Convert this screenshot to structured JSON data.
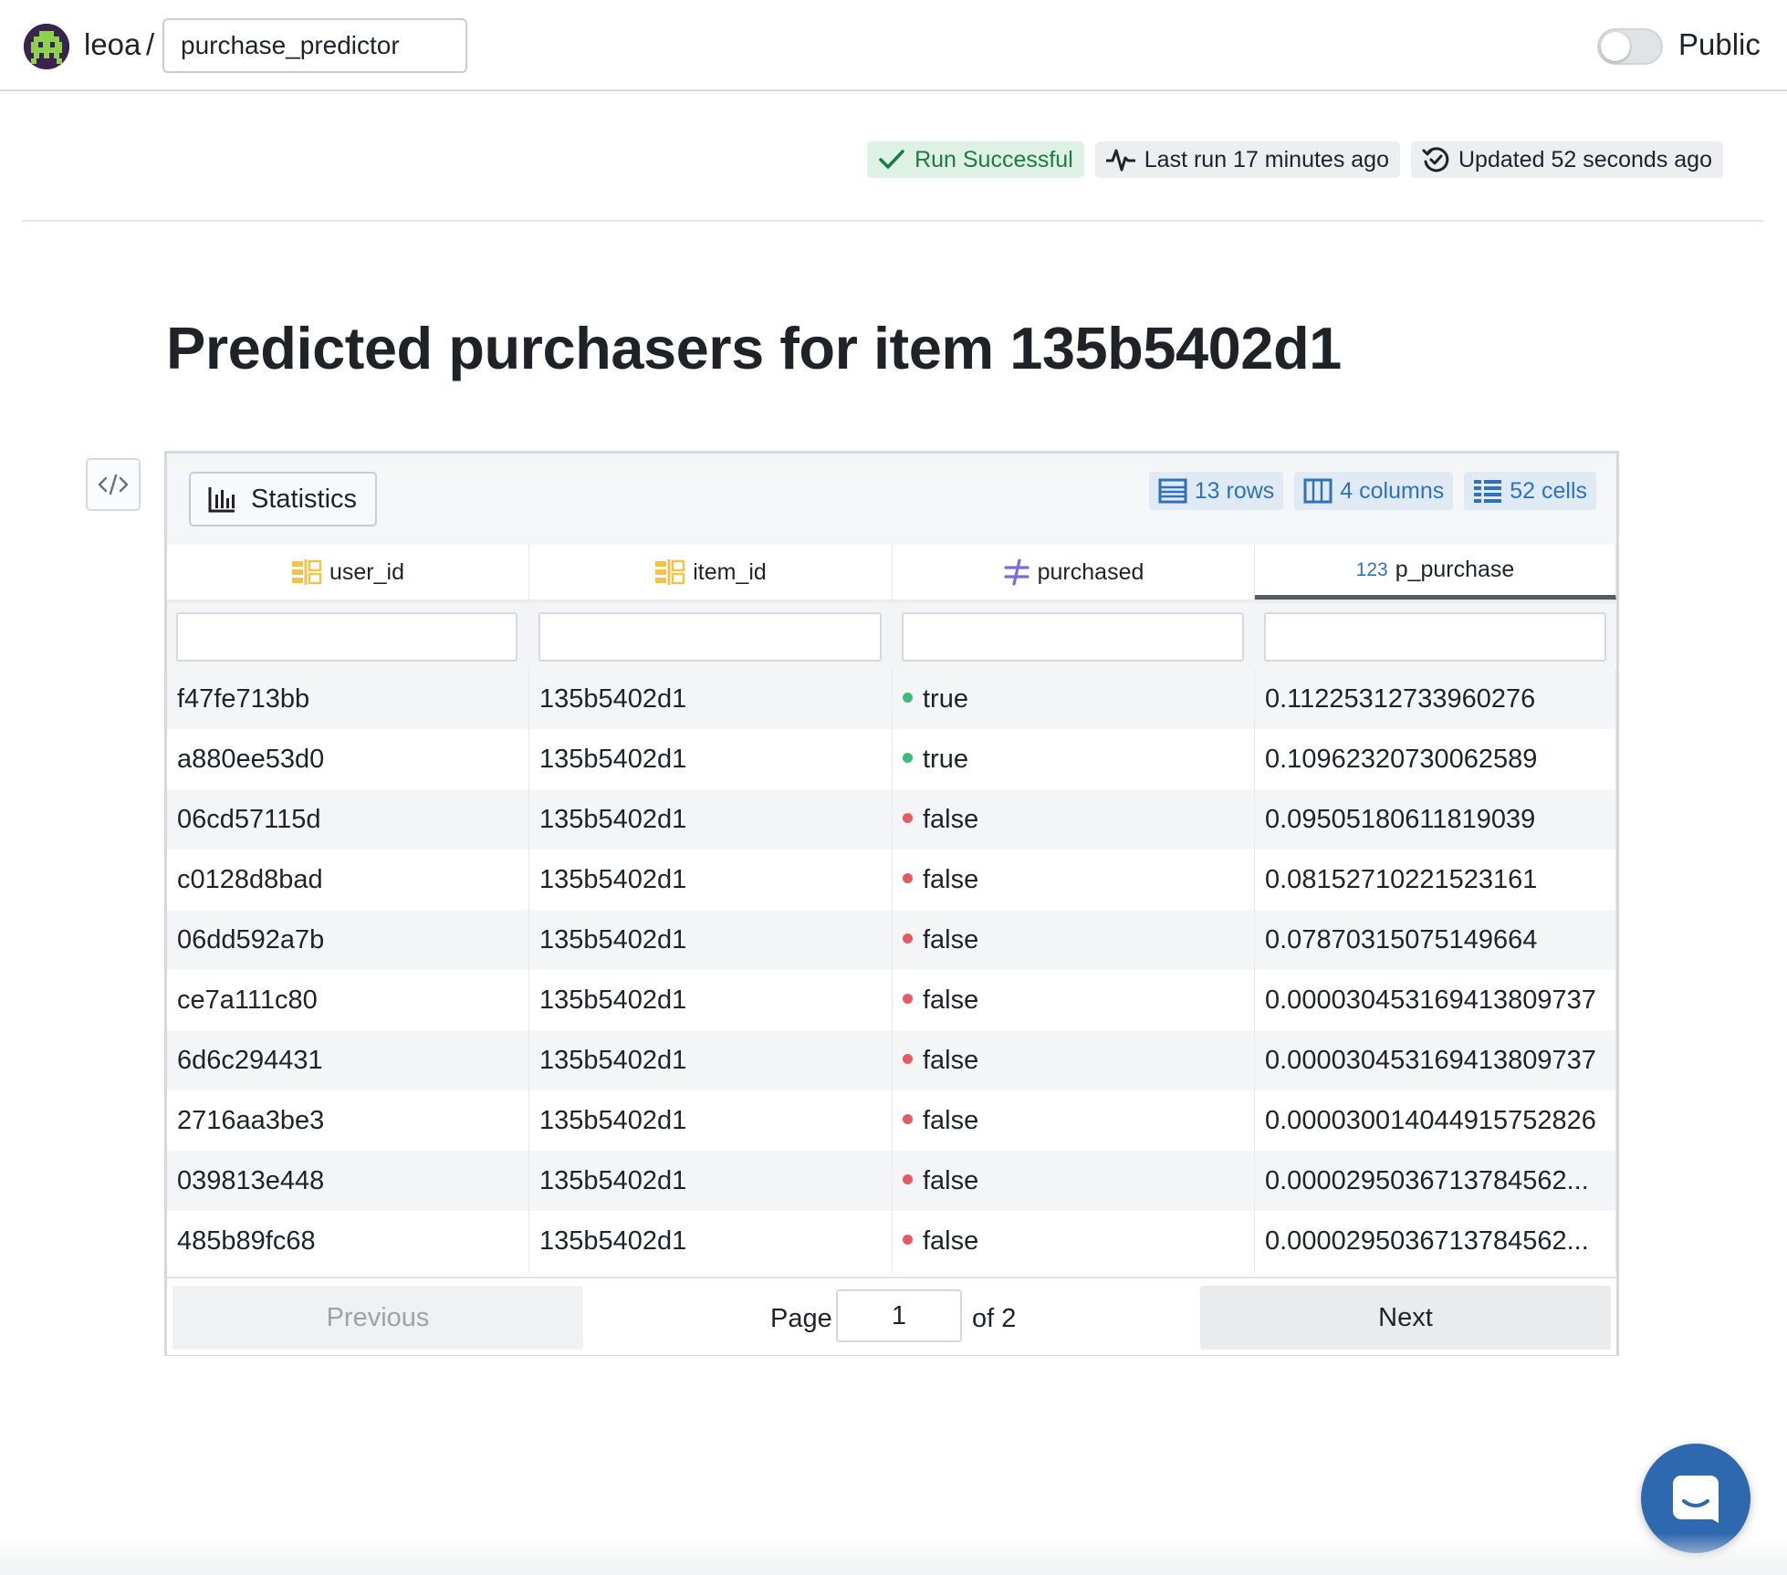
{
  "header": {
    "owner": "leoa",
    "separator": "/",
    "project_name": "purchase_predictor",
    "visibility_label": "Public",
    "visibility_on": false
  },
  "status": {
    "run": "Run Successful",
    "last_run": "Last run 17 minutes ago",
    "updated": "Updated 52 seconds ago"
  },
  "page": {
    "title": "Predicted purchasers for item 135b5402d1"
  },
  "table": {
    "statistics_label": "Statistics",
    "meta": {
      "rows": "13 rows",
      "columns": "4 columns",
      "cells": "52 cells"
    },
    "columns": [
      {
        "name": "user_id",
        "type_icon": "text-column-icon"
      },
      {
        "name": "item_id",
        "type_icon": "text-column-icon"
      },
      {
        "name": "purchased",
        "type_icon": "boolean-column-icon"
      },
      {
        "name": "p_purchase",
        "type_icon": "numeric-column-icon",
        "type_label": "123",
        "sorted": true
      }
    ],
    "rows": [
      {
        "user_id": "f47fe713bb",
        "item_id": "135b5402d1",
        "purchased": "true",
        "p_purchase": "0.11225312733960276"
      },
      {
        "user_id": "a880ee53d0",
        "item_id": "135b5402d1",
        "purchased": "true",
        "p_purchase": "0.10962320730062589"
      },
      {
        "user_id": "06cd57115d",
        "item_id": "135b5402d1",
        "purchased": "false",
        "p_purchase": "0.09505180611819039"
      },
      {
        "user_id": "c0128d8bad",
        "item_id": "135b5402d1",
        "purchased": "false",
        "p_purchase": "0.08152710221523161"
      },
      {
        "user_id": "06dd592a7b",
        "item_id": "135b5402d1",
        "purchased": "false",
        "p_purchase": "0.07870315075149664"
      },
      {
        "user_id": "ce7a111c80",
        "item_id": "135b5402d1",
        "purchased": "false",
        "p_purchase": "0.000030453169413809737"
      },
      {
        "user_id": "6d6c294431",
        "item_id": "135b5402d1",
        "purchased": "false",
        "p_purchase": "0.000030453169413809737"
      },
      {
        "user_id": "2716aa3be3",
        "item_id": "135b5402d1",
        "purchased": "false",
        "p_purchase": "0.000030014044915752826"
      },
      {
        "user_id": "039813e448",
        "item_id": "135b5402d1",
        "purchased": "false",
        "p_purchase": "0.0000295036713784562..."
      },
      {
        "user_id": "485b89fc68",
        "item_id": "135b5402d1",
        "purchased": "false",
        "p_purchase": "0.0000295036713784562..."
      }
    ],
    "pagination": {
      "previous_label": "Previous",
      "page_label": "Page",
      "current_page": "1",
      "of_label": "of 2",
      "next_label": "Next"
    }
  },
  "colors": {
    "success": "#1c7a43",
    "accent": "#2f72b8",
    "true_dot": "#3cbc7a",
    "false_dot": "#e45b62",
    "chat_button": "#2e68ae"
  }
}
